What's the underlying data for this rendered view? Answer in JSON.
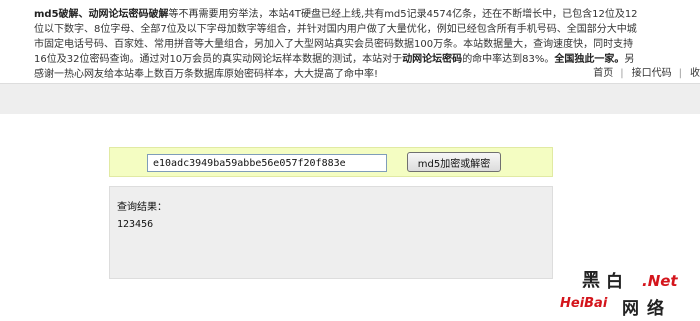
{
  "intro": {
    "p1": "md5破解、动网论坛密码破解",
    "p2": "等不再需要用穷举法，本站4T硬盘已经上线,共有md5记录4574亿条，还在不断增长中，已包含12位及12位以下数字、8位字母、全部7位及以下字母加数字等组合，并针对国内用户做了大量优化，例如已经包含所有手机号码、全国部分大中城市固定电话号码、百家姓、常用拼音等大量组合，另加入了大型网站真实会员密码数据100万条。本站数据量大，查询速度快，同时支持16位及32位密码查询。通过对10万会员的真实动网论坛样本数据的测试，本站对于",
    "p3": "动网论坛密码",
    "p4": "的命中率达到83%。",
    "p5": "全国独此一家。",
    "p6": "另感谢一热心网友给本站奉上数百万条数据库原始密码样本，大大提高了命中率!"
  },
  "nav": {
    "items": [
      "首页",
      "接口代码",
      "收"
    ]
  },
  "search": {
    "value": "e10adc3949ba59abbe56e057f20f883e",
    "button_label": "md5加密或解密"
  },
  "result": {
    "label": "查询结果：",
    "value": "123456"
  },
  "watermark": {
    "cn_left": "黑",
    "cn_right": "白",
    "net": ".Net",
    "latin": "HeiBai",
    "cn_bottom": "网络"
  },
  "colors": {
    "query_bar_bg": "#f4fdc2",
    "result_bg": "#eeeeee",
    "watermark_dark": "#222222",
    "watermark_red": "#d4151c"
  }
}
